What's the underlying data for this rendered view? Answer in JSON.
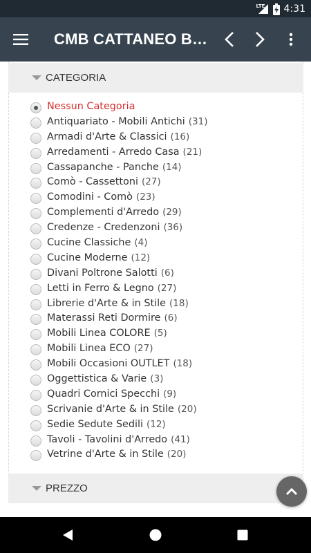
{
  "status_bar": {
    "time": "4:31",
    "network": "LTE",
    "icons": [
      "signal-icon",
      "battery-charging-icon"
    ]
  },
  "app_bar": {
    "title": "CMB CATTANEO BRU...",
    "icons": [
      "menu-icon",
      "back-arrow-icon",
      "forward-arrow-icon",
      "more-vert-icon"
    ]
  },
  "categoria": {
    "header": "CATEGORIA",
    "items": [
      {
        "label": "Nessun Categoria",
        "count": "",
        "selected": true
      },
      {
        "label": "Antiquariato - Mobili Antichi",
        "count": "(31)"
      },
      {
        "label": "Armadi d'Arte & Classici",
        "count": "(16)"
      },
      {
        "label": "Arredamenti - Arredo Casa",
        "count": "(21)"
      },
      {
        "label": "Cassapanche - Panche",
        "count": "(14)"
      },
      {
        "label": "Comò - Cassettoni",
        "count": "(27)"
      },
      {
        "label": "Comodini - Comò",
        "count": "(23)"
      },
      {
        "label": "Complementi d'Arredo",
        "count": "(29)"
      },
      {
        "label": "Credenze - Credenzoni",
        "count": "(36)"
      },
      {
        "label": "Cucine Classiche",
        "count": "(4)"
      },
      {
        "label": "Cucine Moderne",
        "count": "(12)"
      },
      {
        "label": "Divani Poltrone Salotti",
        "count": "(6)"
      },
      {
        "label": "Letti in Ferro & Legno",
        "count": "(27)"
      },
      {
        "label": "Librerie d'Arte & in Stile",
        "count": "(18)"
      },
      {
        "label": "Materassi Reti Dormire",
        "count": "(6)"
      },
      {
        "label": "Mobili Linea COLORE",
        "count": "(5)"
      },
      {
        "label": "Mobili Linea ECO",
        "count": "(27)"
      },
      {
        "label": "Mobili Occasioni OUTLET",
        "count": "(18)"
      },
      {
        "label": "Oggettistica & Varie",
        "count": "(3)"
      },
      {
        "label": "Quadri Cornici Specchi",
        "count": "(9)"
      },
      {
        "label": "Scrivanie d'Arte & in Stile",
        "count": "(20)"
      },
      {
        "label": "Sedie Sedute Sedili",
        "count": "(12)"
      },
      {
        "label": "Tavoli - Tavolini d'Arredo",
        "count": "(41)"
      },
      {
        "label": "Vetrine d'Arte & in Stile",
        "count": "(20)"
      }
    ]
  },
  "prezzo": {
    "header": "PREZZO"
  },
  "colors": {
    "status_bar": "#1f2a32",
    "app_bar": "#37444f",
    "selected_text": "#d32f2f",
    "header_bg": "#eeeeee",
    "fab": "#666666"
  },
  "nav_bar": {
    "icons": [
      "back-icon",
      "home-icon",
      "recents-icon"
    ]
  }
}
